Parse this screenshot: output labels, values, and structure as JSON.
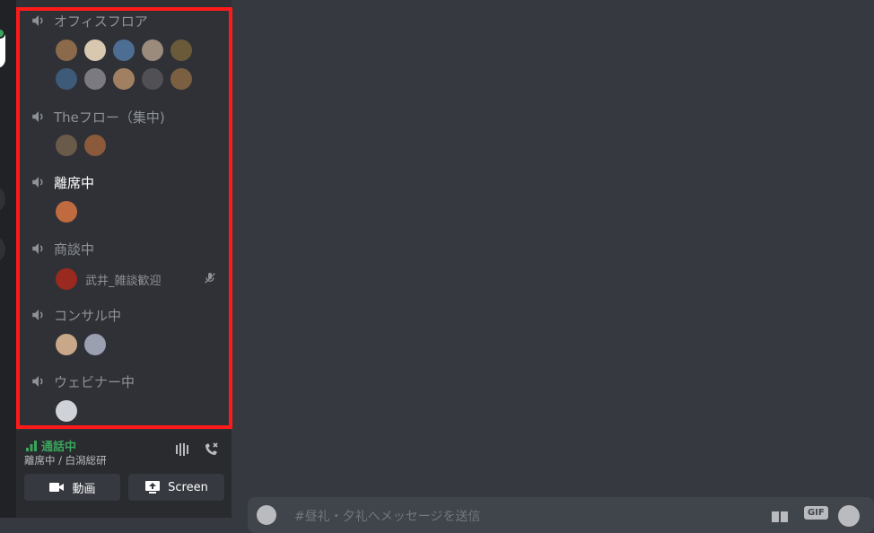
{
  "channels": [
    {
      "name": "オフィスフロア",
      "active": false,
      "avatar_colors": [
        [
          "#8a6a4a",
          "#d8c8b0",
          "#4c6e93",
          "#9a8b7d",
          "#6b5a3a"
        ],
        [
          "#3d5a78",
          "#7a7a80",
          "#a08060",
          "#505055",
          "#7a6040"
        ]
      ]
    },
    {
      "name": "Theフロー（集中)",
      "active": false,
      "avatar_colors": [
        [
          "#6a5a4a",
          "#8a5a3a"
        ]
      ]
    },
    {
      "name": "離席中",
      "active": true,
      "avatar_colors": [
        [
          "#c06a40"
        ]
      ]
    },
    {
      "name": "商談中",
      "active": false,
      "member": {
        "name": "武井_雑談歓迎",
        "avatar_color": "#9a2a20",
        "icon": "mic-muted-icon"
      }
    },
    {
      "name": "コンサル中",
      "active": false,
      "avatar_colors": [
        [
          "#c8a888",
          "#9aa0b0"
        ]
      ]
    },
    {
      "name": "ウェビナー中",
      "active": false,
      "avatar_colors": [
        [
          "#cfd2d8"
        ]
      ]
    }
  ],
  "voice": {
    "status": "通話中",
    "location": "離席中 / 白潟総研",
    "video_label": "動画",
    "screen_label": "Screen",
    "status_color": "#3ba55d"
  },
  "chat": {
    "placeholder": "#昼礼・夕礼へメッセージを送信"
  },
  "highlight_color": "#ff1a1a"
}
